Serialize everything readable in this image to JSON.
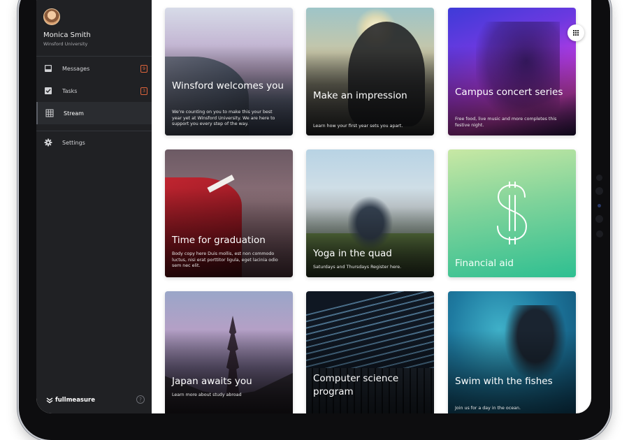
{
  "user": {
    "name": "Monica Smith",
    "org": "Winsford University"
  },
  "nav": [
    {
      "label": "Messages",
      "icon": "inbox-icon",
      "badge": "9"
    },
    {
      "label": "Tasks",
      "icon": "checkbox-icon",
      "badge": "3"
    },
    {
      "label": "Stream",
      "icon": "grid-icon",
      "badge": ""
    },
    {
      "label": "Settings",
      "icon": "gear-icon",
      "badge": ""
    }
  ],
  "brand": {
    "name": "fullmeasure",
    "help": "?"
  },
  "colors": {
    "sidebar": "#202124",
    "badge": "#e0653c",
    "financial_aid": "#2ebf91"
  },
  "cards": [
    {
      "title": "Winsford welcomes you",
      "body": "We're counting on you to make this your best year yet at Winsford University. We are here to support you every step of the way."
    },
    {
      "title": "Make an impression",
      "body": "Learn how your first year sets you apart."
    },
    {
      "title": "Campus concert series",
      "body": "Free food, live music and more completes this festive night."
    },
    {
      "title": "Time for graduation",
      "body": "Body copy here Duis mollis, est non commodo luctus, nisi erat porttitor ligula, eget lacinia odio sem nec elit."
    },
    {
      "title": "Yoga in the quad",
      "body": "Saturdays and Thursdays Register here."
    },
    {
      "title": "Financial aid",
      "body": ""
    },
    {
      "title": "Japan awaits you",
      "body": "Learn more about study abroad"
    },
    {
      "title": "Computer science program",
      "body": ""
    },
    {
      "title": "Swim with the fishes",
      "body": "Join us for a day in the ocean."
    }
  ]
}
